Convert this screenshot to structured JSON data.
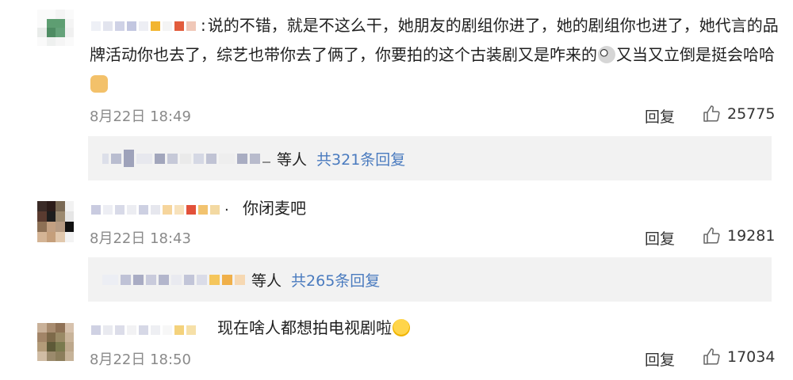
{
  "comments": [
    {
      "text_a": "说的不错，就是不这么干，她朋友的剧组你进了，她的剧组你也进了，她代言的品牌活动你也去了，综艺也带你去了俩了，你要拍的这个古装剧又是咋来的",
      "text_b": "又当又立倒是挺会哈哈",
      "emoji_1": "crazy-face-emoji",
      "emoji_2": "thumbs-up-emoji",
      "time": "8月22日 18:49",
      "reply_label": "回复",
      "likes": "25775",
      "sub": {
        "who": "等人",
        "total": "共321条回复"
      }
    },
    {
      "text_a": "你闭麦吧",
      "time": "8月22日 18:43",
      "reply_label": "回复",
      "likes": "19281",
      "sub": {
        "who": "等人",
        "total": "共265条回复"
      }
    },
    {
      "text_a": "现在啥人都想拍电视剧啦",
      "emoji_1": "thinking-face-emoji",
      "time": "8月22日 18:50",
      "reply_label": "回复",
      "likes": "17034"
    }
  ],
  "colors": {
    "link": "#4a7bbf",
    "time": "#8a8a8a",
    "subbox_bg": "#f2f2f2"
  }
}
